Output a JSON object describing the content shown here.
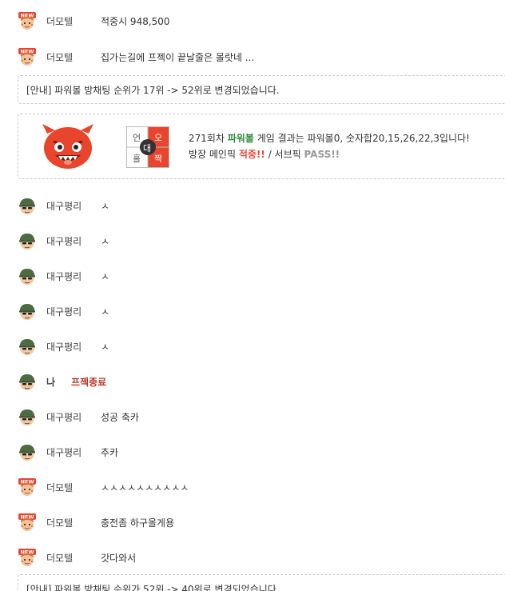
{
  "messages_top": [
    {
      "nick": "더모텔",
      "text": "적중시 948,500",
      "avatar": "new-badge-icon"
    },
    {
      "nick": "더모텔",
      "text": "집가는길에 프젝이 끝날줄은 몰랏네 ...",
      "avatar": "new-badge-icon"
    }
  ],
  "notice1": "[안내] 파워볼 방채팅 순위가 17위 -> 52위로 변경되었습니다.",
  "result": {
    "grid": {
      "top_left": "언",
      "top_right": "오",
      "bottom_left": "홀",
      "bottom_right": "짝",
      "center": "대"
    },
    "line1_prefix": "271회차 ",
    "line1_game": "파워볼",
    "line1_suffix": " 게임 결과는 파워볼0, 숫자합20,15,26,22,3입니다!",
    "line2_prefix": "방장 메인픽 ",
    "line2_hit": "적중!!",
    "line2_mid": " / 서브픽 ",
    "line2_pass": "PASS!!"
  },
  "messages": [
    {
      "nick": "대구평리",
      "text": "ㅅ",
      "avatar": "soldier-icon"
    },
    {
      "nick": "대구평리",
      "text": "ㅅ",
      "avatar": "soldier-icon"
    },
    {
      "nick": "대구평리",
      "text": "ㅅ",
      "avatar": "soldier-icon"
    },
    {
      "nick": "대구평리",
      "text": "ㅅ",
      "avatar": "soldier-icon"
    },
    {
      "nick": "대구평리",
      "text": "ㅅ",
      "avatar": "soldier-icon"
    },
    {
      "nick": "나",
      "text": "프젝종료",
      "avatar": "soldier-icon"
    },
    {
      "nick": "대구평리",
      "text": "성공 축카",
      "avatar": "soldier-icon"
    },
    {
      "nick": "대구평리",
      "text": "추카",
      "avatar": "soldier-icon"
    },
    {
      "nick": "더모텔",
      "text": "ㅅㅅㅅㅅㅅㅅㅅㅅㅅㅅ",
      "avatar": "new-badge-icon"
    },
    {
      "nick": "더모텔",
      "text": "충전좀 하구올게용",
      "avatar": "new-badge-icon"
    },
    {
      "nick": "더모텔",
      "text": "갓다와서",
      "avatar": "new-badge-icon"
    }
  ],
  "notice2": "[안내] 파워볼 방채팅 순위가 52위 -> 40위로 변경되었습니다."
}
